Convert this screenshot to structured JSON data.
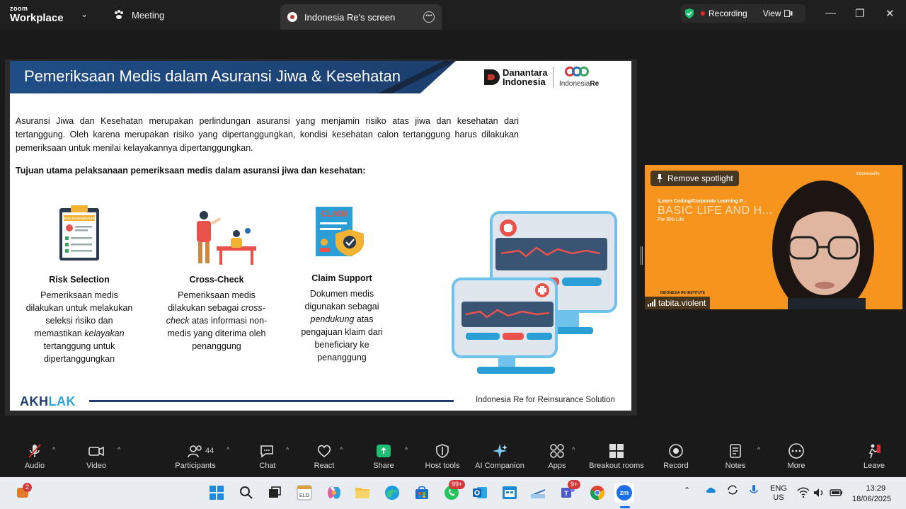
{
  "app": {
    "brand_top": "zoom",
    "brand_bottom": "Workplace",
    "meeting_label": "Meeting",
    "share_tab_title": "Indonesia Re's screen"
  },
  "status": {
    "recording": "Recording",
    "view": "View"
  },
  "slide": {
    "title": "Pemeriksaan Medis dalam Asuransi Jiwa & Kesehatan",
    "logo_dan_line1": "Danantara",
    "logo_dan_line2": "Indonesia",
    "logo_re_prefix": "Indonesia",
    "logo_re_suffix": "Re",
    "paragraph": "Asuransi Jiwa dan Kesehatan merupakan perlindungan asuransi yang menjamin risiko atas jiwa dan kesehatan dari tertanggung. Oleh karena merupakan risiko yang dipertanggungkan, kondisi kesehatan calon tertanggung harus dilakukan pemeriksaan untuk menilai kelayakannya dipertanggungkan.",
    "subheading": "Tujuan utama pelaksanaan pemeriksaan medis dalam asuransi jiwa dan kesehatan:",
    "col1": {
      "heading": "Risk Selection",
      "t1": "Pemeriksaan medis dilakukan untuk melakukan seleksi risiko dan memastikan ",
      "em": "kelayakan",
      "t2": " tertanggung untuk dipertanggungkan",
      "ill_label": "HEALTH INSURANCE"
    },
    "col2": {
      "heading": "Cross-Check",
      "t1": "Pemeriksaan medis dilakukan sebagai ",
      "em": "cross-check",
      "t2": " atas informasi non-medis yang diterima oleh penanggung"
    },
    "col3": {
      "heading": "Claim Support",
      "t1": "Dokumen medis digunakan sebagai ",
      "em": "pendukung",
      "t2": " atas pengajuan klaim dari beneficiary ke penanggung",
      "ill_label": "CLAIM"
    },
    "footer_logo_a": "AKH",
    "footer_logo_b": "LAK",
    "footer_text": "Indonesia Re for Reinsurance Solution"
  },
  "video": {
    "spotlight_button": "Remove spotlight",
    "participant_name": "tabita.violent",
    "bg_line1": "iLearn Coding/Corporate Learning P...",
    "bg_line2": "BASIC LIFE AND H...",
    "bg_line3": "For BNI Life",
    "bg_line4": "INDONESIA RE INSTITUTE",
    "bg_logo": "IndonesiaRe"
  },
  "toolbar": {
    "audio": "Audio",
    "video": "Video",
    "participants": "Participants",
    "participants_count": "44",
    "chat": "Chat",
    "react": "React",
    "share": "Share",
    "host_tools": "Host tools",
    "ai_companion": "AI Companion",
    "apps": "Apps",
    "breakout_rooms": "Breakout rooms",
    "record": "Record",
    "notes": "Notes",
    "more": "More",
    "leave": "Leave"
  },
  "taskbar": {
    "widgets_badge": "2",
    "whatsapp_badge": "99+",
    "teams_badge": "9+",
    "elo_label": "ELO",
    "zoom_label": "zm",
    "lang1": "ENG",
    "lang2": "US",
    "time": "13:29",
    "date": "18/06/2025"
  },
  "colors": {
    "slide_band": "#1f4e86",
    "accent_red": "#e02828",
    "share_green": "#1dbf73",
    "video_orange": "#f7941d"
  }
}
